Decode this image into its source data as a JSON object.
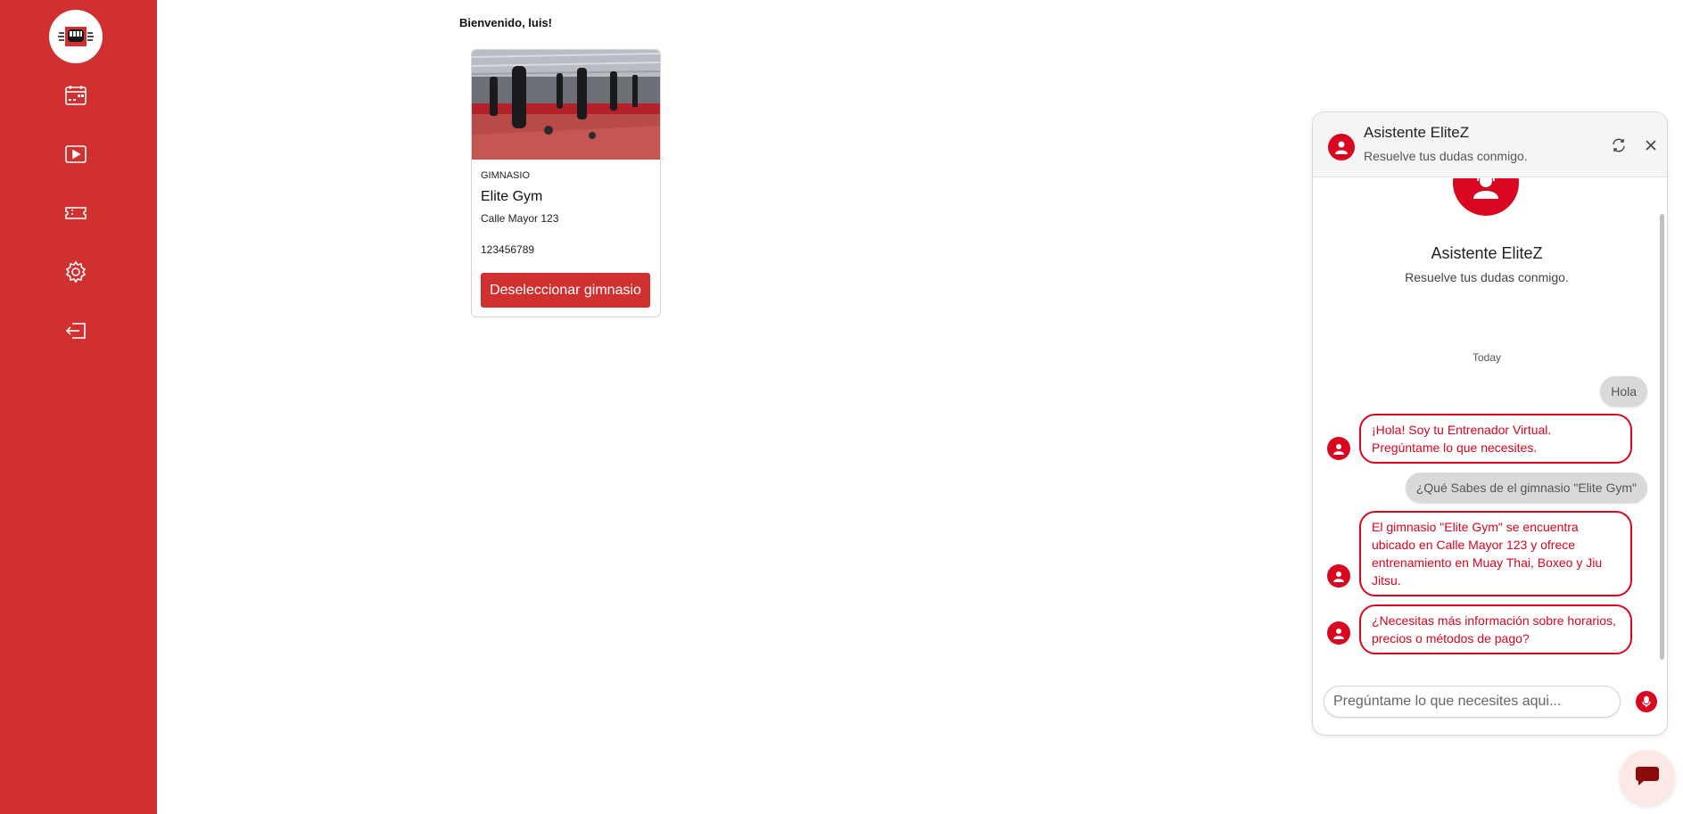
{
  "sidebar": {
    "logo_icon": "fist-logo-icon",
    "items": [
      {
        "icon": "calendar-icon"
      },
      {
        "icon": "play-video-icon"
      },
      {
        "icon": "ticket-icon"
      },
      {
        "icon": "gear-icon"
      },
      {
        "icon": "logout-icon"
      }
    ]
  },
  "main": {
    "welcome": "Bienvenido, luis!",
    "gym_card": {
      "type": "GIMNASIO",
      "name": "Elite Gym",
      "address": "Calle Mayor 123",
      "phone": "123456789",
      "button_label": "Deseleccionar gimnasio"
    }
  },
  "chat": {
    "header": {
      "title": "Asistente EliteZ",
      "subtitle": "Resuelve tus dudas conmigo."
    },
    "intro": {
      "title": "Asistente EliteZ",
      "subtitle": "Resuelve tus dudas conmigo."
    },
    "day_separator": "Today",
    "messages": [
      {
        "from": "user",
        "text": "Hola"
      },
      {
        "from": "bot",
        "text": "¡Hola! Soy tu Entrenador Virtual. Pregúntame lo que necesites."
      },
      {
        "from": "user",
        "text": "¿Qué Sabes de el gimnasio \"Elite Gym\""
      },
      {
        "from": "bot",
        "text": "El gimnasio \"Elite Gym\" se encuentra ubicado en Calle Mayor 123 y ofrece entrenamiento en Muay Thai, Boxeo y Jiu Jitsu."
      },
      {
        "from": "bot",
        "text": "¿Necesitas más información sobre horarios, precios o métodos de pago?"
      }
    ],
    "input_placeholder": "Pregúntame lo que necesites aqui..."
  },
  "colors": {
    "brand_red": "#d0302f",
    "chat_red": "#d9061f",
    "user_bubble": "#d9d9d9"
  }
}
